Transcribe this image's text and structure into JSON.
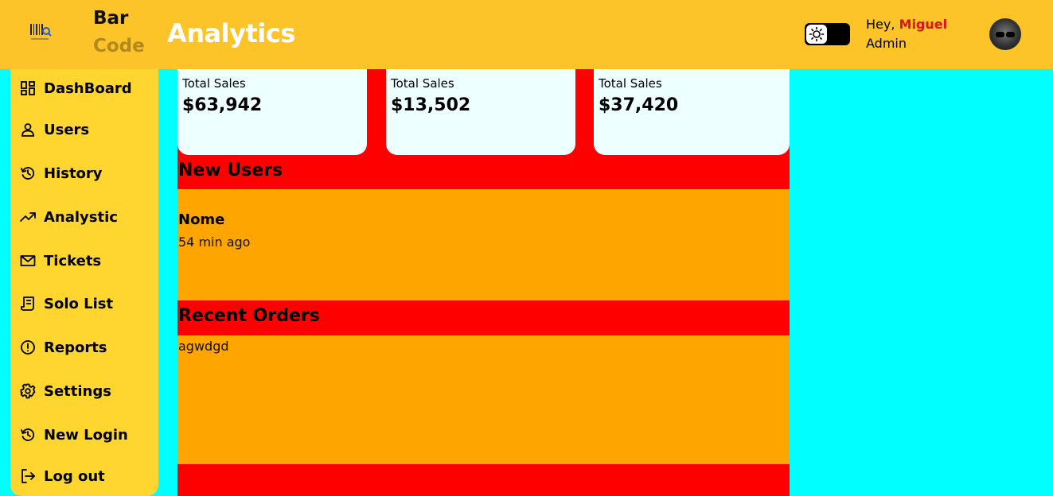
{
  "header": {
    "brand_line1": "Bar",
    "brand_line2": "Code",
    "title": "Analytics",
    "greeting_prefix": "Hey, ",
    "user_name": "Miguel",
    "user_role": "Admin",
    "theme_toggle_icon": "sun-icon"
  },
  "sidebar": {
    "items": [
      {
        "label": "DashBoard",
        "icon": "dashboard-grid-icon"
      },
      {
        "label": "Users",
        "icon": "user-icon"
      },
      {
        "label": "History",
        "icon": "history-icon"
      },
      {
        "label": "Analystic",
        "icon": "trending-up-icon"
      },
      {
        "label": "Tickets",
        "icon": "mail-icon"
      },
      {
        "label": "Solo List",
        "icon": "receipt-icon"
      },
      {
        "label": "Reports",
        "icon": "alert-circle-icon"
      },
      {
        "label": "Settings",
        "icon": "gear-icon"
      },
      {
        "label": "New Login",
        "icon": "history-icon"
      },
      {
        "label": "Log out",
        "icon": "logout-icon"
      }
    ]
  },
  "cards": [
    {
      "label": "Total Sales",
      "value": "$63,942"
    },
    {
      "label": "Total Sales",
      "value": "$13,502"
    },
    {
      "label": "Total Sales",
      "value": "$37,420"
    }
  ],
  "new_users": {
    "title": "New Users",
    "items": [
      {
        "name": "Nome",
        "time": "54 min ago"
      }
    ]
  },
  "recent_orders": {
    "title": "Recent Orders",
    "text": "agwdgd"
  },
  "colors": {
    "header_bg": "#fcc428",
    "sidebar_bg": "#ffd630",
    "page_bg": "#00ffff",
    "main_bg": "#ff0000",
    "panel_bg": "#ffa500",
    "card_bg": "#eeffff",
    "accent_name": "#e0101a"
  }
}
